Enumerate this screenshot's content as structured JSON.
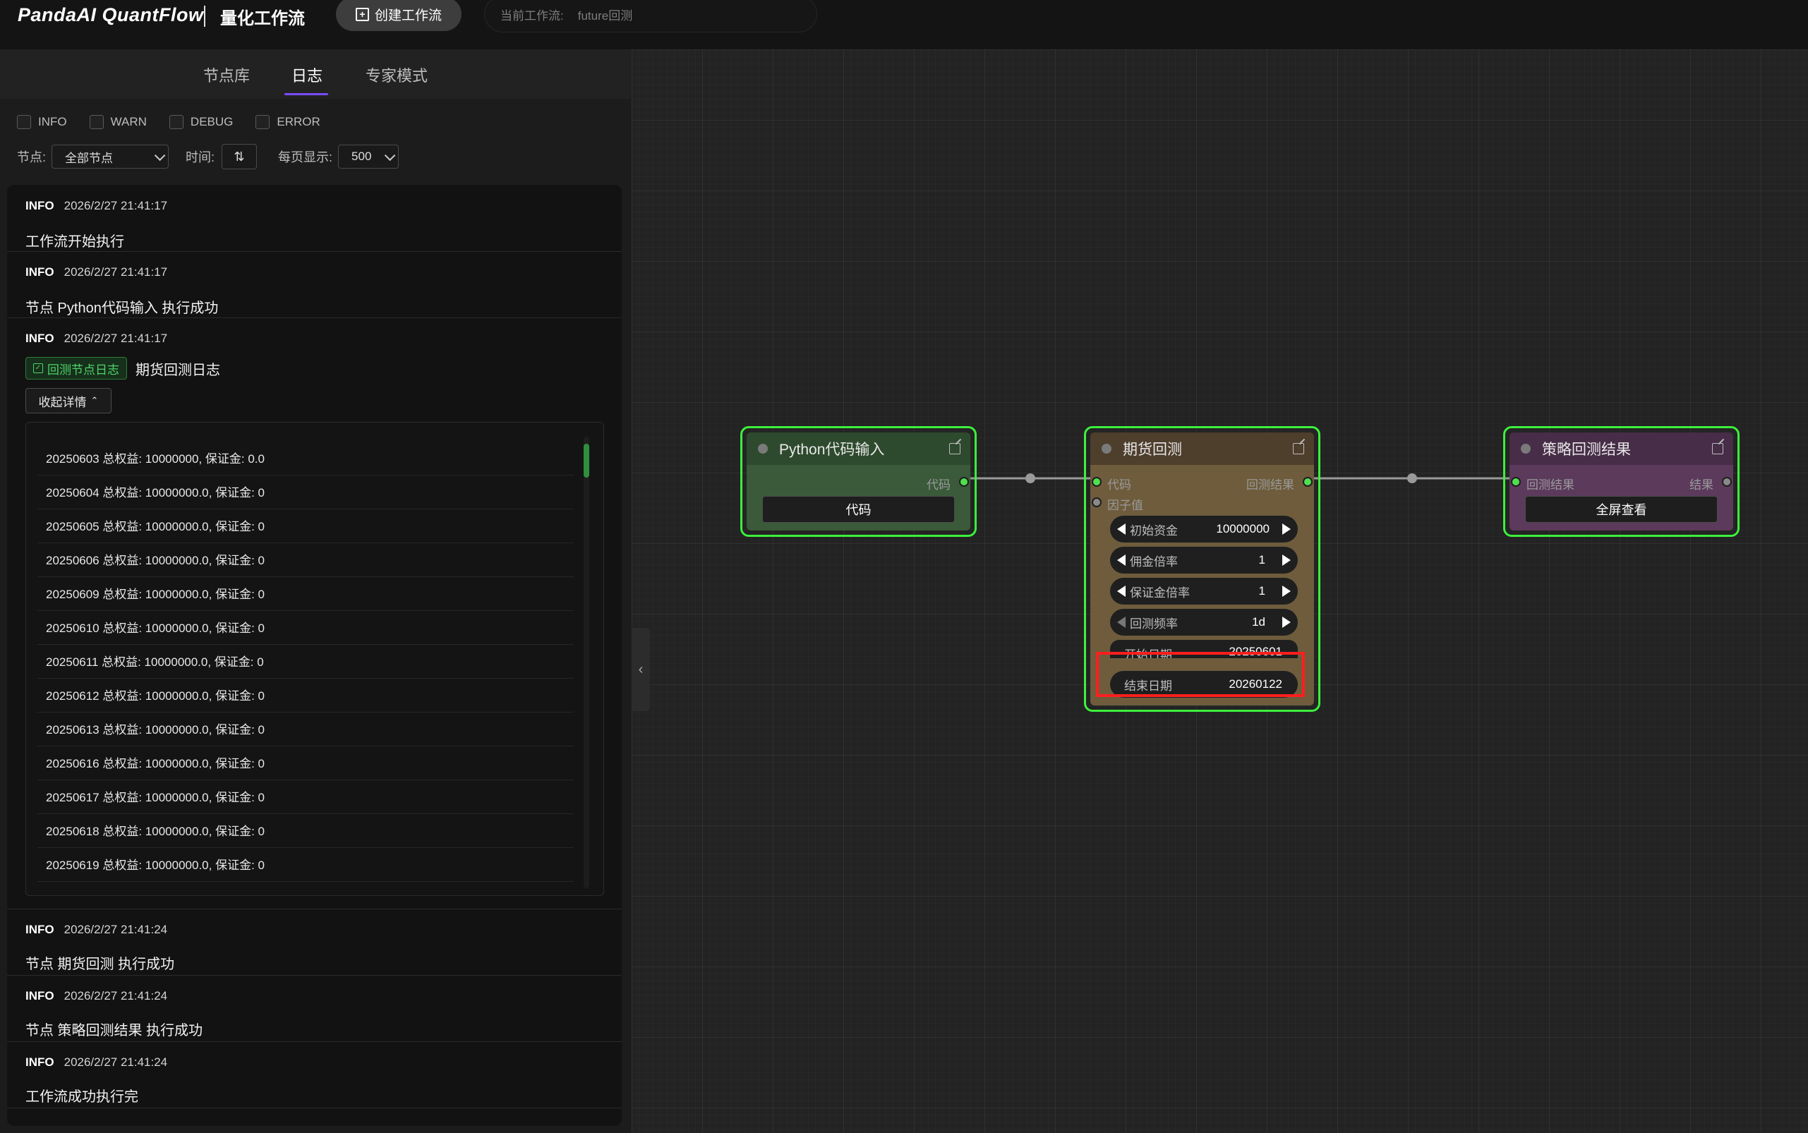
{
  "topbar": {
    "logo": "PandaAI QuantFlow",
    "title": "量化工作流",
    "create_button": "创建工作流",
    "current_workflow_label": "当前工作流:",
    "current_workflow_value": "future回测"
  },
  "panel": {
    "tabs": [
      {
        "label": "节点库",
        "active": false
      },
      {
        "label": "日志",
        "active": true
      },
      {
        "label": "专家模式",
        "active": false
      }
    ],
    "filters": [
      "INFO",
      "WARN",
      "DEBUG",
      "ERROR"
    ],
    "controls": {
      "node_label": "节点:",
      "node_value": "全部节点",
      "time_label": "时间:",
      "page_size_label": "每页显示:",
      "page_size_value": "500"
    },
    "logs": [
      {
        "level": "INFO",
        "time": "2026/2/27 21:41:17",
        "message": "工作流开始执行"
      },
      {
        "level": "INFO",
        "time": "2026/2/27 21:41:17",
        "message": "节点 Python代码输入 执行成功"
      },
      {
        "level": "INFO",
        "time": "2026/2/27 21:41:17",
        "tag": "回测节点日志",
        "message": "期货回测日志",
        "collapse_label": "收起详情"
      },
      {
        "level": "INFO",
        "time": "2026/2/27 21:41:24",
        "message": "节点 期货回测 执行成功"
      },
      {
        "level": "INFO",
        "time": "2026/2/27 21:41:24",
        "message": "节点 策略回测结果 执行成功"
      },
      {
        "level": "INFO",
        "time": "2026/2/27 21:41:24",
        "message": "工作流成功执行完"
      }
    ],
    "details": [
      "20250603 总权益: 10000000, 保证金: 0.0",
      "20250604 总权益: 10000000.0, 保证金: 0",
      "20250605 总权益: 10000000.0, 保证金: 0",
      "20250606 总权益: 10000000.0, 保证金: 0",
      "20250609 总权益: 10000000.0, 保证金: 0",
      "20250610 总权益: 10000000.0, 保证金: 0",
      "20250611 总权益: 10000000.0, 保证金: 0",
      "20250612 总权益: 10000000.0, 保证金: 0",
      "20250613 总权益: 10000000.0, 保证金: 0",
      "20250616 总权益: 10000000.0, 保证金: 0",
      "20250617 总权益: 10000000.0, 保证金: 0",
      "20250618 总权益: 10000000.0, 保证金: 0",
      "20250619 总权益: 10000000.0, 保证金: 0"
    ]
  },
  "nodes": {
    "python": {
      "title": "Python代码输入",
      "output_label": "代码",
      "button": "代码"
    },
    "futures": {
      "title": "期货回测",
      "inputs": [
        "代码",
        "因子值"
      ],
      "output_label": "回测结果",
      "widgets": [
        {
          "label": "初始资金",
          "value": "10000000"
        },
        {
          "label": "佣金倍率",
          "value": "1"
        },
        {
          "label": "保证金倍率",
          "value": "1"
        },
        {
          "label": "回测频率",
          "value": "1d"
        }
      ],
      "start_label": "开始日期",
      "start_value": "20250601",
      "end_label": "结束日期",
      "end_value": "20260122"
    },
    "result": {
      "title": "策略回测结果",
      "input_label": "回测结果",
      "output_label": "结果",
      "button": "全屏查看"
    }
  },
  "colors": {
    "node_border": "#3cf03c",
    "highlight": "#ff1e1e",
    "python_node": "#3a5a3a",
    "futures_node": "#6e5c3c",
    "result_node": "#5c3a5c",
    "tab_accent": "#7a4cff"
  }
}
